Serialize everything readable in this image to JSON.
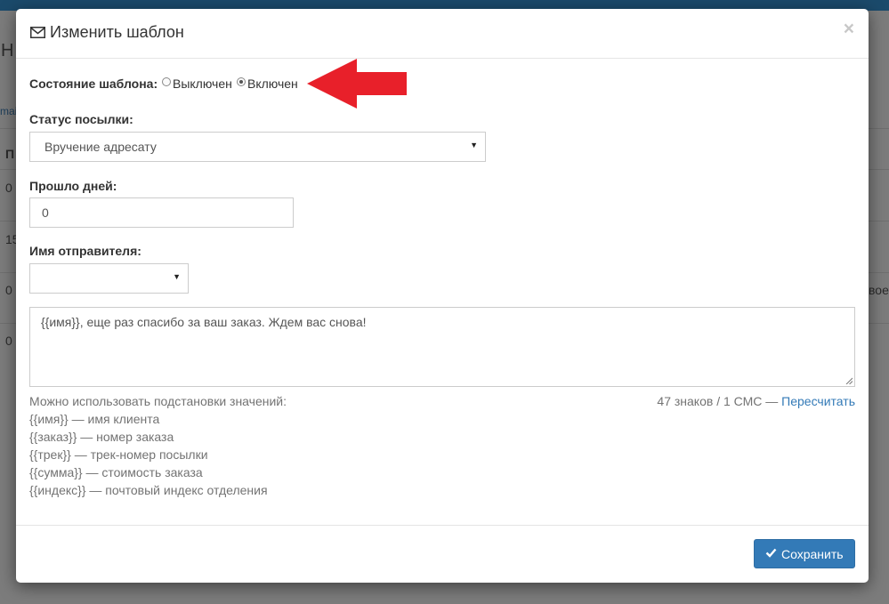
{
  "background": {
    "frag_1": "Н",
    "frag_2": "mai",
    "frag_3": "П",
    "frag_4": "0",
    "frag_5": "15",
    "frag_6": "0",
    "frag_7": "0",
    "frag_8": "вое"
  },
  "modal": {
    "title": "Изменить шаблон",
    "close_symbol": "×",
    "template_state": {
      "label": "Состояние шаблона:",
      "options": [
        {
          "label": "Выключен",
          "checked": false
        },
        {
          "label": "Включен",
          "checked": true
        }
      ]
    },
    "parcel_status": {
      "label": "Статус посылки:",
      "value": "Вручение адресату"
    },
    "days_passed": {
      "label": "Прошло дней:",
      "value": "0"
    },
    "sender_name": {
      "label": "Имя отправителя:",
      "value": ""
    },
    "message": {
      "text": "{{имя}}, еще раз спасибо за ваш заказ. Ждем вас снова!"
    },
    "help": {
      "intro": "Можно использовать подстановки значений:",
      "items": [
        "{{имя}} — имя клиента",
        "{{заказ}} — номер заказа",
        "{{трек}} — трек-номер посылки",
        "{{сумма}} — стоимость заказа",
        "{{индекс}} — почтовый индекс отделения"
      ]
    },
    "counter": {
      "text": "47 знаков / 1 СМС",
      "separator": " — ",
      "recalc_label": "Пересчитать"
    },
    "save_label": "Сохранить"
  },
  "colors": {
    "primary": "#337ab7",
    "arrow": "#e8202a"
  }
}
